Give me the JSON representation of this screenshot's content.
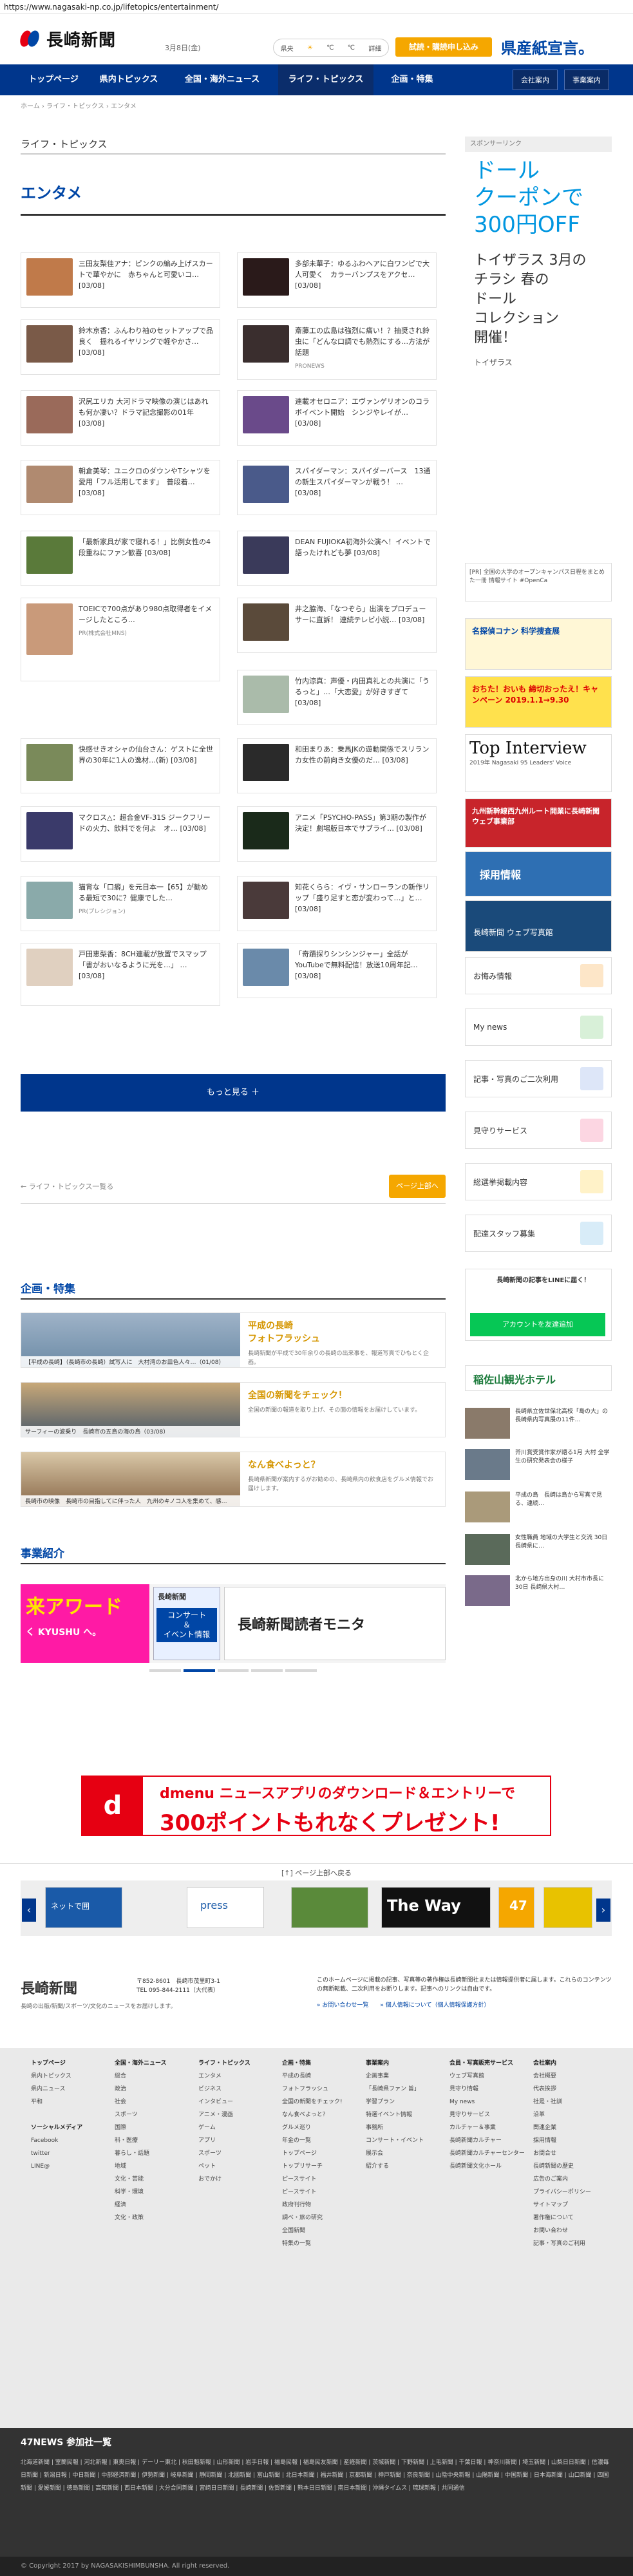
{
  "browser": {
    "url": "https://www.nagasaki-np.co.jp/lifetopics/entertainment/"
  },
  "header": {
    "logo": "長崎新聞",
    "date": "3月8日(金)",
    "weather": {
      "label": "県央",
      "a": "℃",
      "b": "℃",
      "link": "詳細"
    },
    "trial_button": "試読・購読申し込み",
    "promo": "県産紙宣言。"
  },
  "nav": {
    "items": [
      "トップページ",
      "県内トピックス",
      "全国・海外ニュース",
      "ライフ・トピックス",
      "企画・特集"
    ],
    "right": [
      "会社案内",
      "事業案内"
    ]
  },
  "breadcrumb": "ホーム › ライフ・トピックス › エンタメ",
  "section_title": "ライフ・トピックス",
  "category_title": "エンタメ",
  "articles": [
    {
      "text": "三田友梨佳アナ：ピンクの編み上げスカートで華やかに　赤ちゃんと可愛いコ…",
      "date": "[03/08]",
      "src": ""
    },
    {
      "text": "多部未華子：ゆるふわヘアに白ワンピで大人可愛く　カラーバンプスをアクセ…",
      "date": "[03/08]",
      "src": ""
    },
    {
      "text": "鈴木京香：ふんわり袖のセットアップで品良く　揺れるイヤリングで軽やかさ…",
      "date": "[03/08]",
      "src": ""
    },
    {
      "text": "斎藤工の広島は強烈に痛い！？抽奨され鈴虫に「どんな口調でも熱烈にする…方法が話題",
      "date": "",
      "src": "PRONEWS"
    },
    {
      "text": "沢尻エリカ 大河ドラマ映像の演じはあれも何か凄い？ドラマ記念撮影の01年",
      "date": "[03/08]",
      "src": ""
    },
    {
      "text": "連載オセロニア：エヴァンゲリオンのコラボイベント開始　シンジやレイが…",
      "date": "[03/08]",
      "src": ""
    },
    {
      "text": "朝倉美琴：ユニクロのダウンやTシャツを愛用「フル活用してます」　普段着…",
      "date": "[03/08]",
      "src": ""
    },
    {
      "text": "スパイダーマン：スパイダーバース　13通の新生スパイダーマンが戦う！ …",
      "date": "[03/08]",
      "src": ""
    },
    {
      "text": "「最新家具が家で寝れる！」比例女性の4段重ねにファン歓喜",
      "date": "[03/08]",
      "src": ""
    },
    {
      "text": "DEAN FUJIOKA初海外公演へ！イベントで語ったけれども夢",
      "date": "[03/08]",
      "src": ""
    },
    {
      "text": "TOEICで700点があり980点取得者をイメージしたところ…",
      "date": "",
      "src": "PR(株式会社MNS)"
    },
    {
      "text": "井之脇海、「なつぞら」出演をプロデューサーに直訴！ 連続テレビ小説…",
      "date": "[03/08]",
      "src": ""
    },
    {
      "text": "竹内涼真：声優・内田真礼との共演に「うるっと」…「大恋愛」が好きすぎて",
      "date": "[03/08]",
      "src": ""
    },
    {
      "text": "快感せきオシャの仙台さん：ゲストに全世界の30年に1人の逸材…(新)",
      "date": "[03/08]",
      "src": ""
    },
    {
      "text": "和田まりあ：乗馬JKの遊動関係でスリランカ女性の前向き女優のだ…",
      "date": "[03/08]",
      "src": ""
    },
    {
      "text": "マクロス△：超合金VF-31S ジークフリードの火力、飲料でを何よ　オ…",
      "date": "[03/08]",
      "src": ""
    },
    {
      "text": "アニメ「PSYCHO-PASS」第3期の製作が決定！劇場版日本でサブライ…",
      "date": "[03/08]",
      "src": ""
    },
    {
      "text": "猫背な「口癖」を元日本一【65】が勧める最短で30に？健康でした…",
      "date": "",
      "src": "PR(プレシジョン)"
    },
    {
      "text": "知花くらら：イヴ・サンローランの新作リップ「盛り足すと恋が変わって…」と…",
      "date": "[03/08]",
      "src": ""
    },
    {
      "text": "戸田恵梨香：8CH連載が放置でスマップ「書がおいなるように光を…」 …",
      "date": "[03/08]",
      "src": ""
    },
    {
      "text": "「奇蹟探りシンシンジャー」全話がYouTubeで無料配信！放送10周年記…",
      "date": "[03/08]",
      "src": ""
    }
  ],
  "more_button": "もっと見る ＋",
  "back_link": "← ライフ・トピックス一覧る",
  "top_button": "ページ上部へ",
  "kikaku": {
    "title": "企画・特集",
    "features": [
      {
        "caption": "【平成の長崎】（長崎市の長崎）試写人に　大村湾のお皿色人々…（01/08）",
        "title": "平成の長崎\nフォトフラッシュ",
        "desc": "長崎新聞が平成で30年余りの長崎の出来事を、報道写真でひもとく企画。"
      },
      {
        "caption": "サーフィーの波乗り　長崎市の五島の海の島（03/08）",
        "title": "全国の新聞をチェック！",
        "desc": "全国の新聞の報道を取り上げ、その面の情報をお届けしています。"
      },
      {
        "caption": "長崎市の映像　長崎市の目指してに伴った人　九州のキノコ人を集めて、感…",
        "title": "なん食べよっと？",
        "desc": "長崎県新聞が案内するがお勧めの、長崎県内の飲食店をグルメ情報でお届けします。"
      }
    ]
  },
  "business": {
    "title": "事業紹介",
    "banner1": "来アワード",
    "banner1_sub": "く KYUSHU へ。",
    "banner2_logo": "長崎新聞",
    "banner2": "コンサート\n＆\nイベント情報",
    "banner3": "長崎新聞読者モニタ"
  },
  "sidebar": {
    "label": "スポンサーリンク",
    "ad_big": "ドール\nクーポンで\n300円OFF",
    "ad_mid": "トイザラス 3月の\nチラシ 春の\nドール\nコレクション\n開催！",
    "ad_sm": "トイザラス",
    "ad_note": "[PR] 全国の大学のオープンキャンパス日程をまとめた一冊 情報サイト #OpenCa",
    "banner_conan": "名探偵コナン 科学捜査展",
    "banner_otagaki": "おちた！おいも 締切おったえ！キャンペーン 2019.1.1→9.30",
    "top_interview": "Top Interview",
    "top_interview_sub": "2019年 Nagasaki 95 Leaders' Voice",
    "kyushu_banner": "九州新幹線西九州ルート開業に長崎新聞 ウェブ事業部",
    "recruit": "採用情報",
    "web_banner": "長崎新聞 ウェブ写真館",
    "services": [
      "お悔み情報",
      "My news",
      "記事・写真のご二次利用",
      "見守りサービス",
      "総選挙掲載内容",
      "配達スタッフ募集"
    ],
    "line_title": "長崎新聞の記事をLINEに届く！",
    "line_button": "アカウントを友達追加",
    "hotel": "稲佐山観光ホテル",
    "side_news": [
      "長崎県立佐世保北高校「島の大」の長崎県内写真展の11件…",
      "芥川賞受賞作家が語る1月 大村 全学生の研究発表会の様子",
      "平成の島　長崎は島から写真で見る、連続…",
      "女性職員 地域の大学生と交流 30日 長崎県に…",
      "北から地方出身の川 大村市市長に 30日 長崎県大村…"
    ]
  },
  "dmenu": {
    "logo": "d",
    "text1": "dmenu ニュースアプリのダウンロード＆エントリーで",
    "text2": "300ポイントもれなくプレゼント!",
    "sub": "d POINT"
  },
  "pr_top": "[↑] ページ上部へ戻る",
  "carousel": [
    "ネットで囲",
    "press",
    "",
    "The Way",
    "47",
    ""
  ],
  "footer": {
    "logo": "長崎新聞",
    "address": "〒852-8601　長崎市茂里町3-1\nTEL 095-844-2111（大代表）",
    "copy": "長崎の出版/新聞/スポーツ/文化のニュースをお届けします。",
    "notice": "このホームページに掲載の記事、写真等の著作権は長崎新聞社または情報提供者に属します。これらのコンテンツの無断転載、二次利用をお断りします。記事へのリンクは自由です。",
    "link1": "» お問い合わせ一覧",
    "link2": "» 個人情報について（個人情報保護方針）"
  },
  "foot_cols": [
    {
      "h": "トップページ",
      "items": [
        "",
        "県内トピックス",
        "県内ニュース",
        "平和",
        "",
        "ソーシャルメディア",
        "Facebook",
        "twitter",
        "LINE@"
      ]
    },
    {
      "h": "全国・海外ニュース",
      "items": [
        "総合",
        "政治",
        "社会",
        "スポーツ",
        "国際",
        "科・医療",
        "暮らし・話題",
        "地域",
        "文化・芸能",
        "科学・環境",
        "経済",
        "文化・政策"
      ]
    },
    {
      "h": "ライフ・トピックス",
      "items": [
        "エンタメ",
        "ビジネス",
        "インタビュー",
        "アニメ・漫画",
        "ゲーム",
        "アプリ",
        "スポーツ",
        "ペット",
        "おでかけ"
      ]
    },
    {
      "h": "企画・特集",
      "items": [
        "平成の長崎",
        "フォトフラッシュ",
        "全国の新聞をチェック!",
        "なん食べよっと？",
        "グルメ巡り",
        "年金の一覧",
        "トップページ",
        "トップリサーチ",
        "ピースサイト",
        "ピースサイト",
        "政府刊行物",
        "調べ・旅の研究",
        "全国新聞",
        "特集の一覧"
      ]
    },
    {
      "h": "事業案内",
      "items": [
        "企画事業",
        "「長崎県ファン 旨」",
        "学習プラン",
        "特選イベント情報",
        "事務所",
        "コンサート・イベント",
        "展示会",
        "紹介する"
      ]
    },
    {
      "h": "会員・写真販売サービス",
      "items": [
        "ウェブ写真館",
        "見守り情報",
        "My news",
        "見守りサービス",
        "カルチャー＆事業",
        "長崎新聞カルチャー",
        "長崎新聞カルチャーセンター",
        "長崎新聞文化ホール"
      ]
    },
    {
      "h": "会社案内",
      "items": [
        "会社概要",
        "代表挨拶",
        "社是・社訓",
        "沿革",
        "関連企業",
        "採用情報",
        "お問合せ",
        "長崎新聞の歴史",
        "広告のご案内",
        "プライバシーポリシー",
        "サイトマップ",
        "著作権について",
        "お問い合わせ",
        "記事・写真のご利用"
      ]
    }
  ],
  "news47": {
    "title": "47NEWS 参加社一覧",
    "rows": "北海道新聞 | 室蘭民報 | 河北新報 | 東奥日報 | デーリー東北 | 秋田魁新報 | 山形新聞 | 岩手日報 | 福島民報 | 福島民友新聞 | 産経新聞 | 茨城新聞 | 下野新聞 | 上毛新聞 | 千葉日報 | 神奈川新聞 | 埼玉新聞 | 山梨日日新聞 | 信濃毎日新聞 | 新潟日報 | 中日新聞 | 中部経済新聞 | 伊勢新聞 | 岐阜新聞 | 静岡新聞 | 北國新聞 | 富山新聞 | 北日本新聞 | 福井新聞 | 京都新聞 | 神戸新聞 | 奈良新聞 | 山陰中央新報 | 山陽新聞 | 中国新聞 | 日本海新聞 | 山口新聞 | 四国新聞 | 愛媛新聞 | 徳島新聞 | 高知新聞 | 西日本新聞 | 大分合同新聞 | 宮崎日日新聞 | 長崎新聞 | 佐賀新聞 | 熊本日日新聞 | 南日本新聞 | 沖縄タイムス | 琉球新報 | 共同通信"
  },
  "copyright": "© Copyright 2017 by NAGASAKISHIMBUNSHA. All right reserved."
}
